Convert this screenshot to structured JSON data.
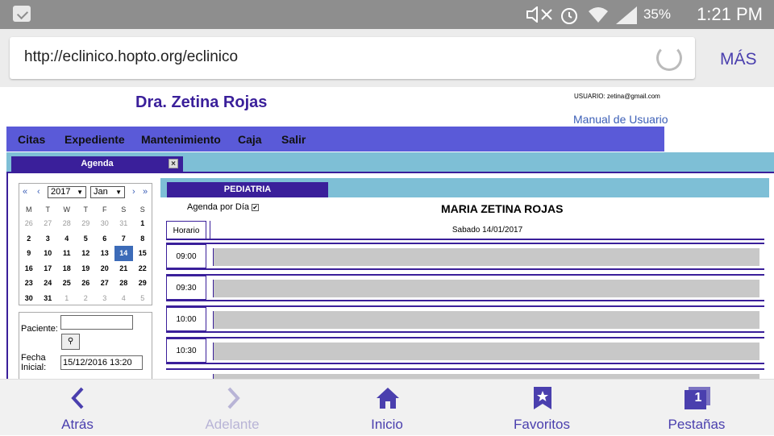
{
  "status_bar": {
    "battery": "35%",
    "time": "1:21 PM",
    "icons": [
      "briefcase-icon",
      "mute-icon",
      "alarm-icon",
      "wifi-icon",
      "signal-icon",
      "battery-icon"
    ]
  },
  "browser": {
    "url": "http://eclinico.hopto.org/eclinico",
    "more_label": "MÁS"
  },
  "header": {
    "doctor_title": "Dra. Zetina Rojas",
    "user_label": "USUARIO: zetina@gmail.com",
    "manual_link": "Manual de Usuario"
  },
  "menu": {
    "items": [
      "Citas",
      "Expediente",
      "Mantenimiento",
      "Caja",
      "Salir"
    ]
  },
  "tabs": {
    "agenda": "Agenda",
    "close_glyph": "×"
  },
  "calendar": {
    "prev_year": "«",
    "prev_month": "‹",
    "next_month": "›",
    "next_year": "»",
    "year": "2017",
    "month": "Jan",
    "weekdays": [
      "M",
      "T",
      "W",
      "T",
      "F",
      "S",
      "S"
    ],
    "weeks": [
      [
        "26",
        "27",
        "28",
        "29",
        "30",
        "31",
        "1"
      ],
      [
        "2",
        "3",
        "4",
        "5",
        "6",
        "7",
        "8"
      ],
      [
        "9",
        "10",
        "11",
        "12",
        "13",
        "14",
        "15"
      ],
      [
        "16",
        "17",
        "18",
        "19",
        "20",
        "21",
        "22"
      ],
      [
        "23",
        "24",
        "25",
        "26",
        "27",
        "28",
        "29"
      ],
      [
        "30",
        "31",
        "1",
        "2",
        "3",
        "4",
        "5"
      ]
    ],
    "selected_day": "14"
  },
  "patient_panel": {
    "paciente_label": "Paciente:",
    "paciente_value": "",
    "search_glyph": "🔍",
    "fecha_label": "Fecha Inicial:",
    "fecha_value": "15/12/2016 13:20"
  },
  "schedule": {
    "specialty_tab": "PEDIATRIA",
    "agenda_por_dia": "Agenda por Día",
    "agenda_checked": "✔",
    "doctor_name": "MARIA ZETINA ROJAS",
    "horario_label": "Horario",
    "date_label": "Sabado 14/01/2017",
    "slots": [
      "09:00",
      "09:30",
      "10:00",
      "10:30"
    ]
  },
  "bottom_nav": {
    "back": "Atrás",
    "forward": "Adelante",
    "home": "Inicio",
    "favorites": "Favoritos",
    "tabs": "Pestañas",
    "tab_count": "1"
  }
}
